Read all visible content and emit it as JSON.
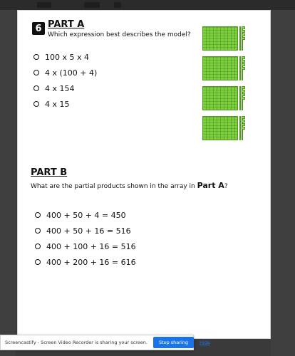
{
  "question": {
    "number": "6"
  },
  "part_a": {
    "title": "PART A",
    "question": "Which expression best describes the model?",
    "options": [
      "100 x 5 x 4",
      "4 x (100 + 4)",
      "4 x 154",
      "4 x 15"
    ]
  },
  "part_b": {
    "title": "PART B",
    "question_before": "What are the partial products shown in the array in ",
    "question_emph": "Part A",
    "question_after": "?",
    "options": [
      "400 + 50 + 4 = 450",
      "400 + 50 + 16 = 516",
      "400 + 100 + 16 = 516",
      "400 + 200 + 16 = 616"
    ]
  },
  "notification": {
    "message": "Screencastify - Screen Video Recorder is sharing your screen.",
    "stop_label": "Stop sharing",
    "hide_label": "Hide"
  },
  "colors": {
    "block_green": "#7bd13b",
    "button_blue": "#1a73e8"
  }
}
